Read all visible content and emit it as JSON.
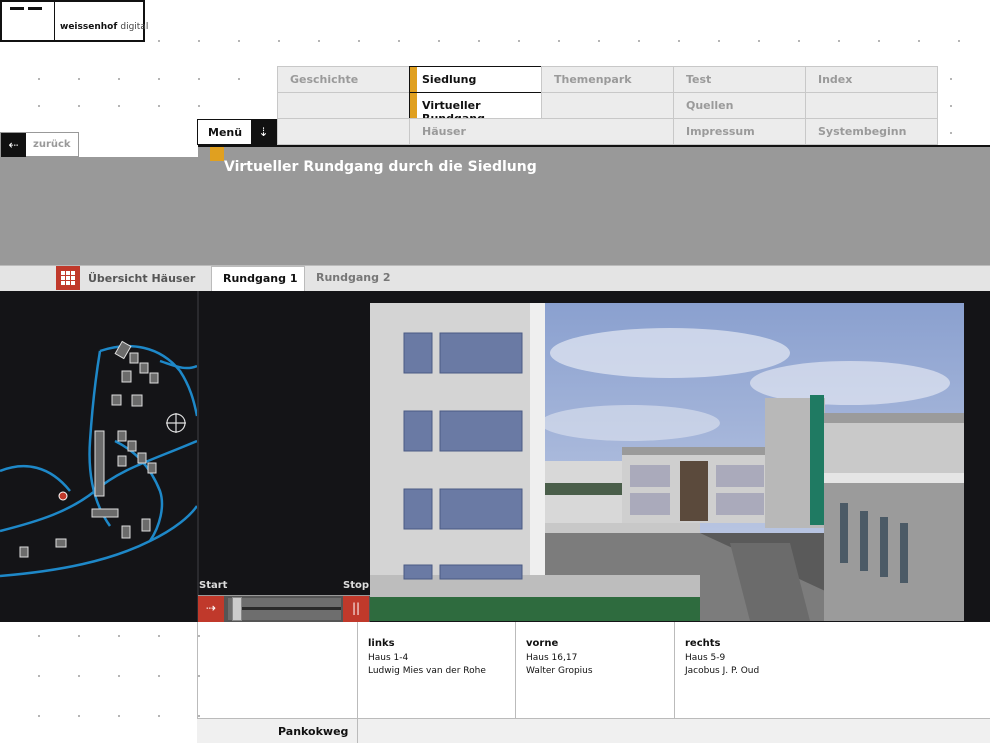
{
  "brand": {
    "name_bold": "weissenhof",
    "name_light": "digital"
  },
  "nav": {
    "back_label": "zurück",
    "menu_label": "Menü",
    "row1": [
      "Geschichte",
      "Siedlung",
      "Themenpark",
      "Test",
      "Index"
    ],
    "row2": [
      "",
      "Virtueller Rundgang",
      "",
      "Quellen",
      ""
    ],
    "row3": [
      "",
      "Häuser",
      "Impressum",
      "Systembeginn"
    ]
  },
  "page": {
    "title": "Virtueller Rundgang durch die Siedlung"
  },
  "tabs": {
    "overview_label": "Übersicht Häuser",
    "tab1": "Rundgang 1",
    "tab2": "Rundgang 2"
  },
  "player": {
    "start_label": "Start",
    "stop_label": "Stop",
    "progress": 0.04
  },
  "info": {
    "left": {
      "heading": "links",
      "line1": "Haus 1-4",
      "line2": "Ludwig Mies van der Rohe"
    },
    "front": {
      "heading": "vorne",
      "line1": "Haus 16,17",
      "line2": "Walter Gropius"
    },
    "right": {
      "heading": "rechts",
      "line1": "Haus 5-9",
      "line2": "Jacobus J. P. Oud"
    },
    "street": "Pankokweg"
  },
  "colors": {
    "accent_orange": "#e0a020",
    "accent_red": "#c0392b",
    "band_gray": "#999999",
    "map_line": "#1e88c8"
  }
}
